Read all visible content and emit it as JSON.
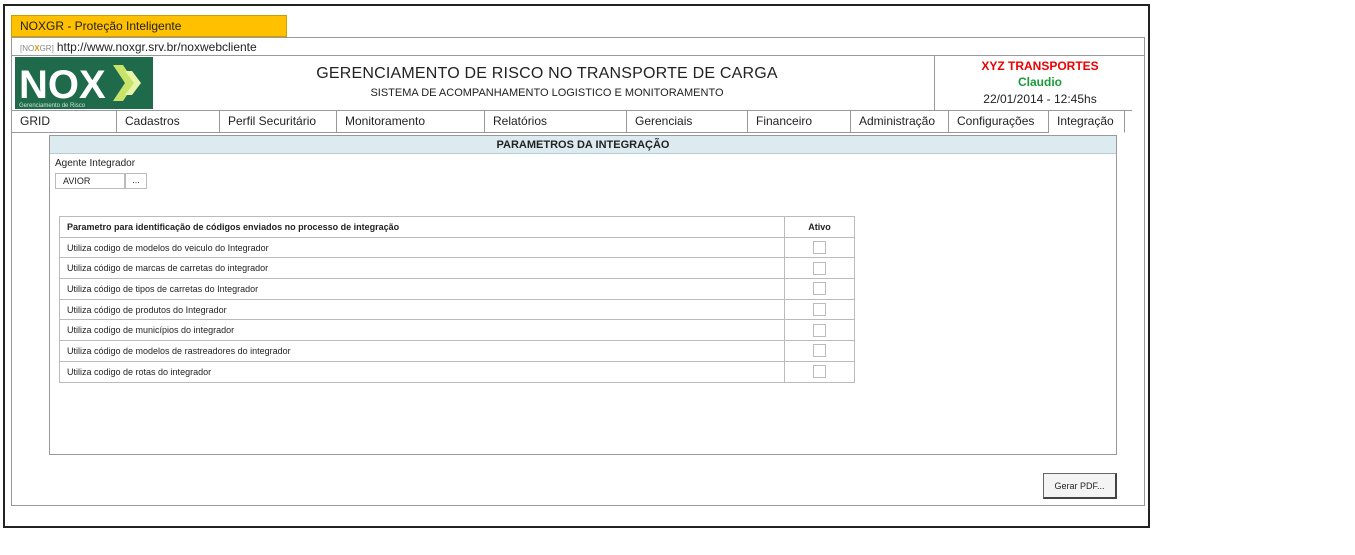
{
  "window": {
    "title": "NOXGR - Proteção Inteligente",
    "favicon_text_a": "[NO",
    "favicon_text_b": "X",
    "favicon_text_c": "GR]",
    "url": "http://www.noxgr.srv.br/noxwebcliente"
  },
  "logo": {
    "text": "NOX",
    "tagline": "Gerenciamento de Risco"
  },
  "header": {
    "title": "GERENCIAMENTO DE RISCO NO TRANSPORTE DE CARGA",
    "subtitle": "SISTEMA DE ACOMPANHAMENTO LOGISTICO  E MONITORAMENTO",
    "company": "XYZ TRANSPORTES",
    "user": "Claudio",
    "datetime": "22/01/2014 - 12:45hs"
  },
  "menu": [
    {
      "label": "GRID"
    },
    {
      "label": "Cadastros"
    },
    {
      "label": "Perfil Securitário"
    },
    {
      "label": "Monitoramento"
    },
    {
      "label": "Relatórios"
    },
    {
      "label": "Gerenciais"
    },
    {
      "label": "Financeiro"
    },
    {
      "label": "Administração"
    },
    {
      "label": "Configurações"
    },
    {
      "label": "Integração"
    }
  ],
  "panel": {
    "title": "PARAMETROS DA INTEGRAÇÃO",
    "agent_label": "Agente Integrador",
    "agent_value": "AVIOR",
    "agent_button": "..."
  },
  "params_table": {
    "header_desc": "Parametro para identificação de códigos enviados no processo de integração",
    "header_ativo": "Ativo",
    "rows": [
      {
        "label": "Utiliza codigo de modelos do veiculo do Integrador",
        "checked": false
      },
      {
        "label": "Utiliza código de marcas de carretas do integrador",
        "checked": false
      },
      {
        "label": "Utiliza código de tipos de carretas do Integrador",
        "checked": false
      },
      {
        "label": "Utiliza código de produtos do Integrador",
        "checked": false
      },
      {
        "label": "Utiliza codigo de municípios do integrador",
        "checked": false
      },
      {
        "label": "Utiliza  código de modelos de rastreadores do integrador",
        "checked": false
      },
      {
        "label": "Utiliza codigo de rotas do integrador",
        "checked": false
      }
    ]
  },
  "actions": {
    "pdf_button": "Gerar PDF..."
  },
  "colors": {
    "title_bar": "#ffc000",
    "panel_header": "#dcebf0",
    "company": "#ee0000",
    "user": "#1a9a3a",
    "logo_bg": "#1e6a4a"
  }
}
